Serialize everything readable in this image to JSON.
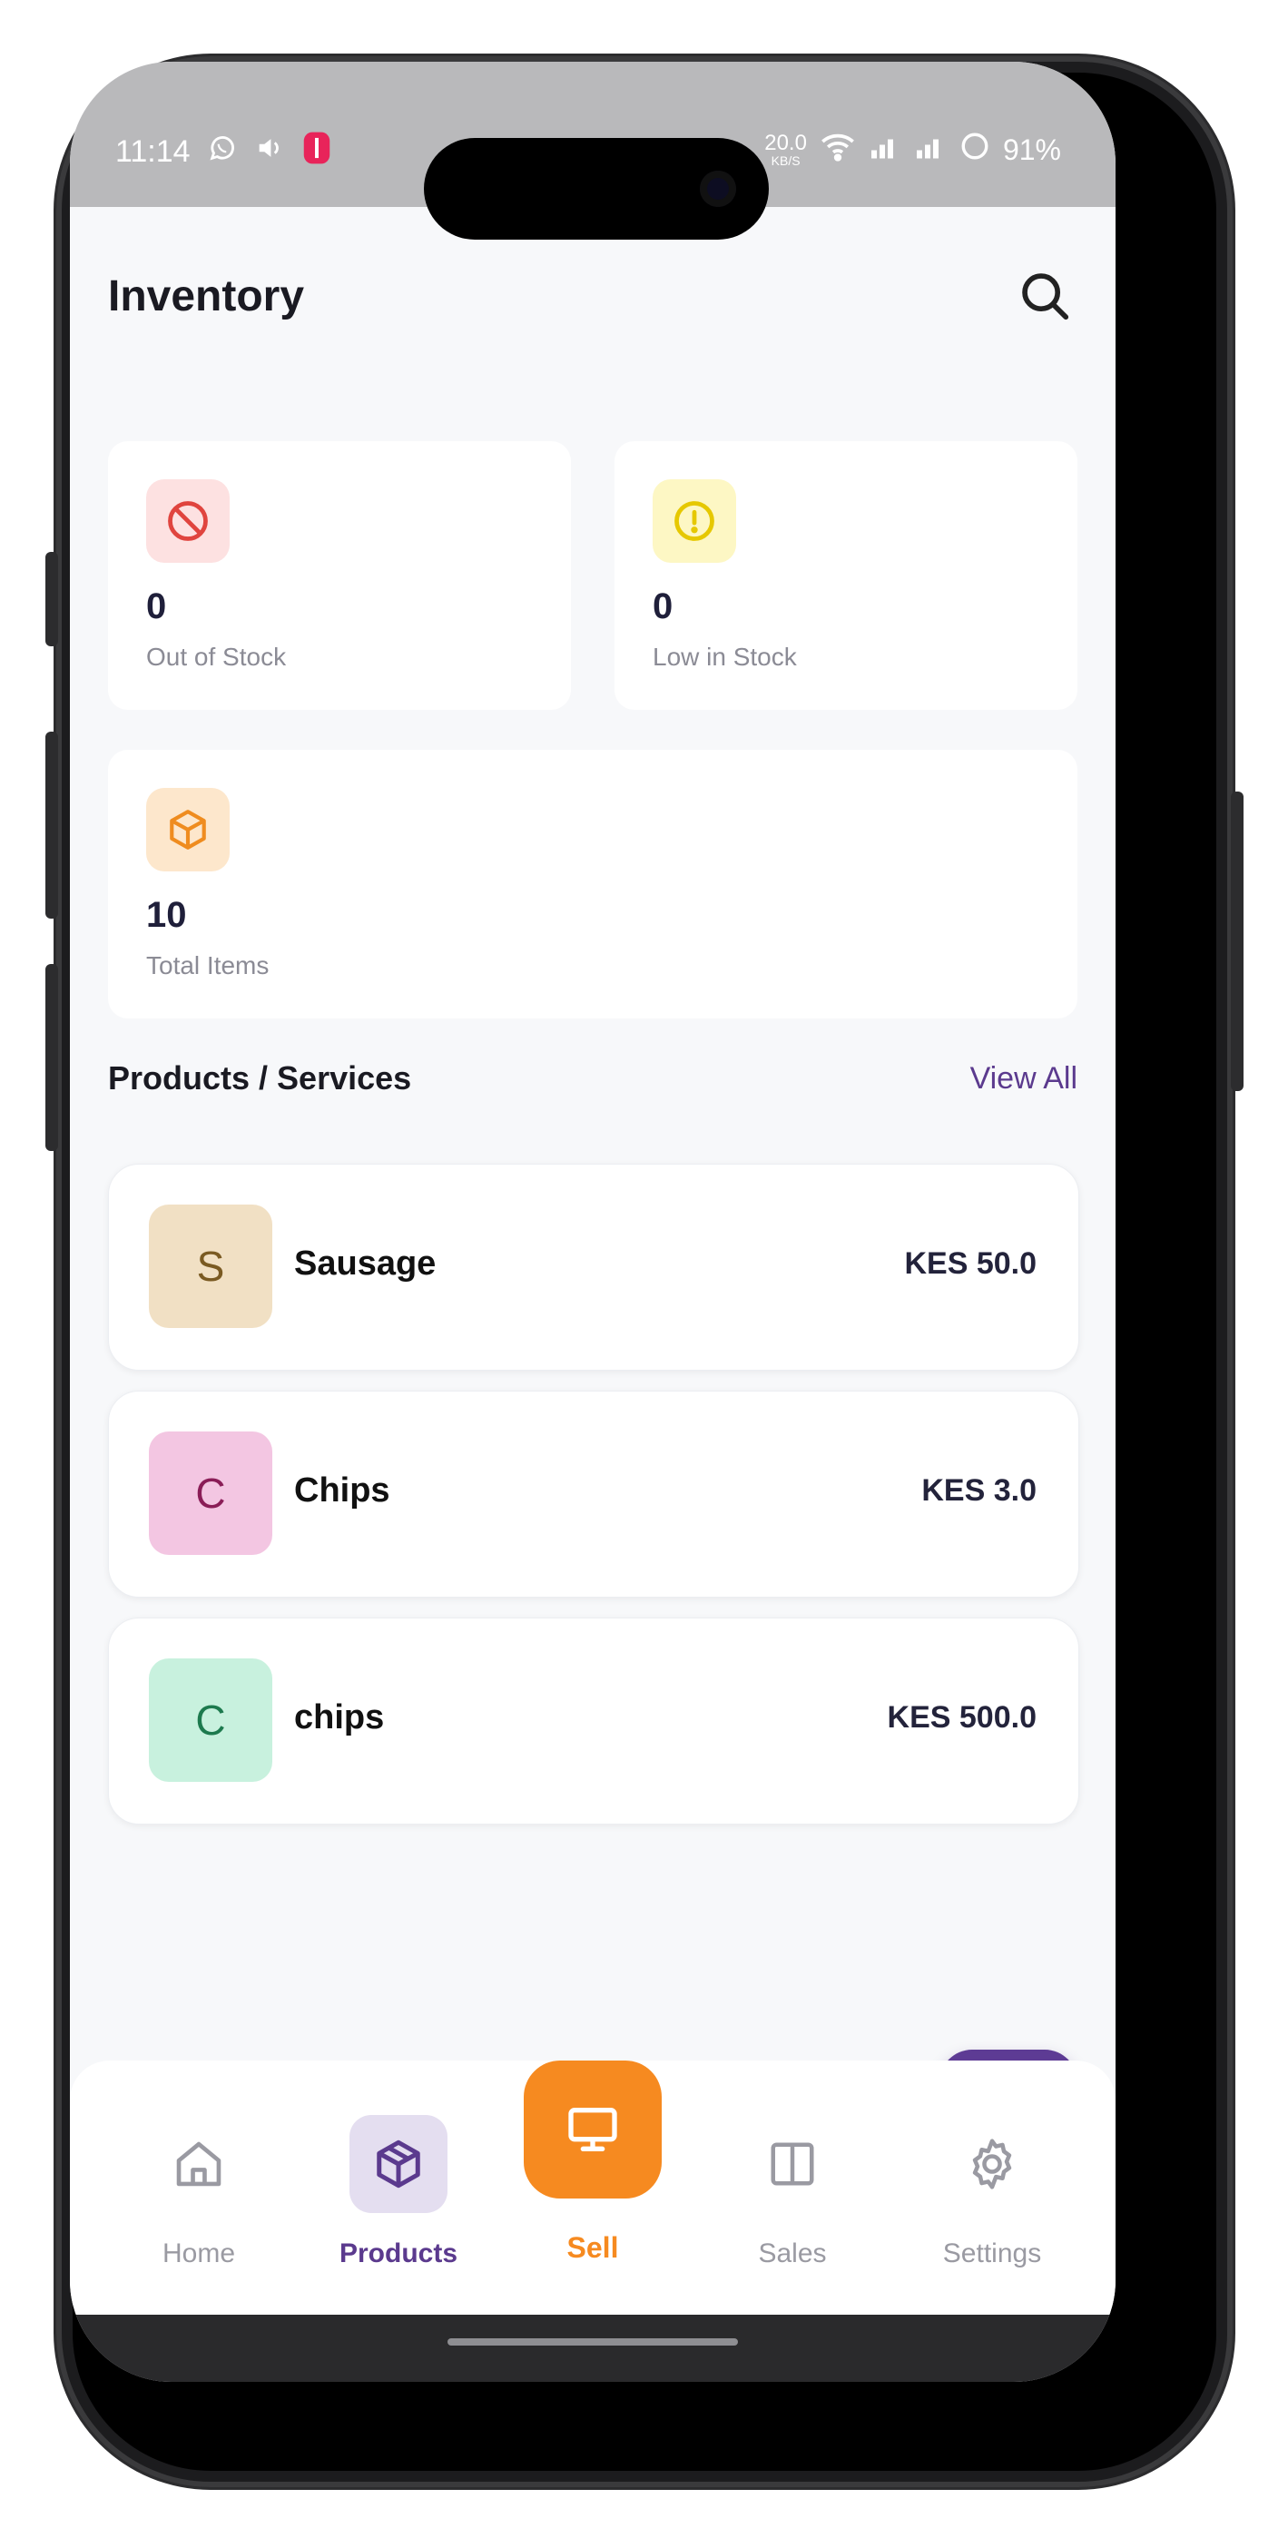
{
  "status_bar": {
    "time": "11:14",
    "speed": "20.0",
    "speed_unit": "KB/S",
    "battery": "91%"
  },
  "header": {
    "title": "Inventory"
  },
  "stats": [
    {
      "value": "0",
      "label": "Out of Stock",
      "icon": "block-icon",
      "bg": "#fde1e1",
      "color": "#e0443e"
    },
    {
      "value": "0",
      "label": "Low in Stock",
      "icon": "alert-circle-icon",
      "bg": "#fdf7c4",
      "color": "#e6c800"
    },
    {
      "value": "10",
      "label": "Total Items",
      "icon": "box-icon",
      "bg": "#fde7cc",
      "color": "#ef8c1f"
    }
  ],
  "products_section": {
    "title": "Products / Services",
    "view_all": "View All"
  },
  "products": [
    {
      "initial": "S",
      "name": "Sausage",
      "price": "KES 50.0",
      "bg": "#f1e0c4",
      "fg": "#7a5a22"
    },
    {
      "initial": "C",
      "name": "Chips",
      "price": "KES 3.0",
      "bg": "#f3c6e2",
      "fg": "#8a1d57"
    },
    {
      "initial": "C",
      "name": "chips",
      "price": "KES 500.0",
      "bg": "#c8f1de",
      "fg": "#1d7a4e"
    }
  ],
  "fab": {
    "icon": "plus-icon"
  },
  "nav": {
    "home": "Home",
    "products": "Products",
    "sell": "Sell",
    "sales": "Sales",
    "settings": "Settings",
    "active": "products",
    "active_color": "#5b3a8e",
    "sell_color": "#f68a20"
  }
}
